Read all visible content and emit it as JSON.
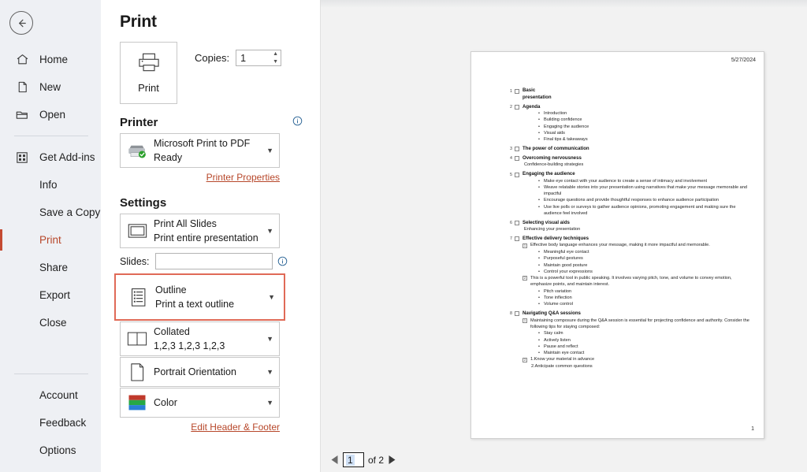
{
  "nav": {
    "back_label": "Back",
    "items": [
      {
        "label": "Home",
        "icon": "home-icon",
        "selected": false
      },
      {
        "label": "New",
        "icon": "new-document-icon",
        "selected": false
      },
      {
        "label": "Open",
        "icon": "open-folder-icon",
        "selected": false
      },
      {
        "label": "Get Add-ins",
        "icon": "add-ins-grid-icon",
        "selected": false
      },
      {
        "label": "Info",
        "icon": "",
        "selected": false
      },
      {
        "label": "Save a Copy",
        "icon": "",
        "selected": false
      },
      {
        "label": "Print",
        "icon": "",
        "selected": true
      },
      {
        "label": "Share",
        "icon": "",
        "selected": false
      },
      {
        "label": "Export",
        "icon": "",
        "selected": false
      },
      {
        "label": "Close",
        "icon": "",
        "selected": false
      }
    ],
    "bottom_items": [
      {
        "label": "Account"
      },
      {
        "label": "Feedback"
      },
      {
        "label": "Options"
      }
    ],
    "accent_color": "#c44a32"
  },
  "print": {
    "page_title": "Print",
    "print_button_label": "Print",
    "copies_label": "Copies:",
    "copies_value": "1",
    "printer_heading": "Printer",
    "printer_name": "Microsoft Print to PDF",
    "printer_status": "Ready",
    "printer_properties_link": "Printer Properties",
    "settings_heading": "Settings",
    "slides_label": "Slides:",
    "slides_value": "",
    "slides_placeholder": "",
    "edit_header_footer_link": "Edit Header & Footer",
    "highlight_color": "#e06a57",
    "options": [
      {
        "name": "print-range",
        "title": "Print All Slides",
        "subtitle": "Print entire presentation",
        "icon": "slide-rectangle-icon",
        "highlighted": false
      },
      {
        "name": "print-layout",
        "title": "Outline",
        "subtitle": "Print a text outline",
        "icon": "outline-list-icon",
        "highlighted": true
      },
      {
        "name": "collation",
        "title": "Collated",
        "subtitle": "1,2,3   1,2,3   1,2,3",
        "icon": "collate-pages-icon",
        "highlighted": false
      },
      {
        "name": "orientation",
        "title": "Portrait Orientation",
        "subtitle": "",
        "icon": "portrait-page-icon",
        "highlighted": false
      },
      {
        "name": "color-mode",
        "title": "Color",
        "subtitle": "",
        "icon": "color-swatch-icon",
        "highlighted": false
      }
    ]
  },
  "preview": {
    "date": "5/27/2024",
    "page_footer_number": "1",
    "pager": {
      "current_page": "1",
      "of_label": "of 2",
      "prev_label": "Previous Page",
      "next_label": "Next Page"
    },
    "outline": [
      {
        "num": "1",
        "kind": "slide",
        "title": "Basic",
        "title2": "presentation",
        "lines": []
      },
      {
        "num": "2",
        "kind": "slide",
        "title": "Agenda",
        "lines": [
          {
            "type": "bullet",
            "text": "Introduction"
          },
          {
            "type": "bullet",
            "text": "Building confidence"
          },
          {
            "type": "bullet",
            "text": "Engaging the audience"
          },
          {
            "type": "bullet",
            "text": "Visual aids"
          },
          {
            "type": "bullet",
            "text": "Final tips & takeaways"
          }
        ]
      },
      {
        "num": "3",
        "kind": "slide",
        "title": "The power of communication",
        "lines": []
      },
      {
        "num": "4",
        "kind": "slide",
        "title": "Overcoming nervousness",
        "lines": [
          {
            "type": "plain",
            "text": "Confidence-building strategies"
          }
        ]
      },
      {
        "num": "5",
        "kind": "slide",
        "title": "Engaging the audience",
        "lines": [
          {
            "type": "bullet",
            "text": "Make eye contact with your audience to create a sense of intimacy and involvement"
          },
          {
            "type": "bullet",
            "text": "Weave relatable stories into your presentation using narratives that make your message memorable and impactful"
          },
          {
            "type": "bullet",
            "text": "Encourage questions and provide thoughtful responses to enhance audience participation"
          },
          {
            "type": "bullet",
            "text": "Use live polls or surveys to gather audience opinions, promoting engagement and making sure the audience feel involved"
          }
        ]
      },
      {
        "num": "6",
        "kind": "slide",
        "title": "Selecting visual aids",
        "lines": [
          {
            "type": "plain",
            "text": "Enhancing your presentation"
          }
        ]
      },
      {
        "num": "7",
        "kind": "slide",
        "title": "Effective delivery techniques",
        "lines": [
          {
            "type": "note",
            "marker": "1",
            "text": "Effective body language enhances your message, making it more impactful and memorable."
          },
          {
            "type": "bullet",
            "text": "Meaningful eye contact"
          },
          {
            "type": "bullet",
            "text": "Purposeful gestures"
          },
          {
            "type": "bullet",
            "text": "Maintain good posture"
          },
          {
            "type": "bullet",
            "text": "Control your expressions"
          },
          {
            "type": "note",
            "marker": "2",
            "text": "This is a powerful tool in public speaking. It involves varying pitch, tone, and volume to convey emotion, emphasize points, and maintain interest."
          },
          {
            "type": "bullet",
            "text": "Pitch variation"
          },
          {
            "type": "bullet",
            "text": "Tone inflection"
          },
          {
            "type": "bullet",
            "text": "Volume control"
          }
        ]
      },
      {
        "num": "8",
        "kind": "slide",
        "title": "Navigating Q&A sessions",
        "lines": [
          {
            "type": "note",
            "marker": "1",
            "text": "Maintaining composure during the Q&A session is essential for projecting confidence and authority. Consider the following tips for staying composed:"
          },
          {
            "type": "bullet",
            "text": "Stay calm"
          },
          {
            "type": "bullet",
            "text": "Actively listen"
          },
          {
            "type": "bullet",
            "text": "Pause and reflect"
          },
          {
            "type": "bullet",
            "text": "Maintain eye contact"
          },
          {
            "type": "note",
            "marker": "2",
            "text": "1.Know your material in advance"
          },
          {
            "type": "plain2",
            "text": "2.Anticipate common questions"
          }
        ]
      }
    ]
  }
}
